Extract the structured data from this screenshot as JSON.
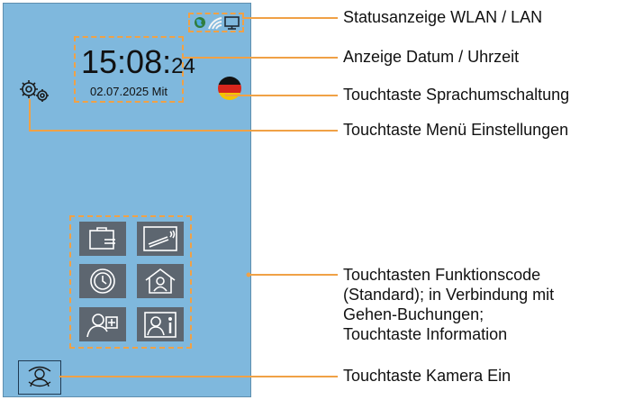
{
  "device": {
    "time_hm": "15:08:",
    "time_ss": "24",
    "date": "02.07.2025 Mit"
  },
  "icons": {
    "status": [
      "globe-icon",
      "wifi-icon",
      "lan-monitor-icon"
    ],
    "settings": "gears-icon",
    "language": "german-flag-icon",
    "camera": "face-camera-icon",
    "function_tiles": [
      "briefcase-exit-icon",
      "smoking-break-icon",
      "clock-icon",
      "home-office-icon",
      "user-add-icon",
      "user-info-icon"
    ]
  },
  "colors": {
    "screen_bg": "#7fb8dd",
    "tile_bg": "#5d6670",
    "callout_orange": "#f0a146"
  },
  "callouts": {
    "status": "Statusanzeige WLAN / LAN",
    "datetime": "Anzeige Datum / Uhrzeit",
    "language": "Touchtaste Sprachumschaltung",
    "settings": "Touchtaste Menü Einstellungen",
    "function_lines": [
      "Touchtasten Funktionscode",
      "(Standard); in Verbindung mit",
      "Gehen-Buchungen;",
      "Touchtaste Information"
    ],
    "camera": "Touchtaste Kamera Ein"
  }
}
